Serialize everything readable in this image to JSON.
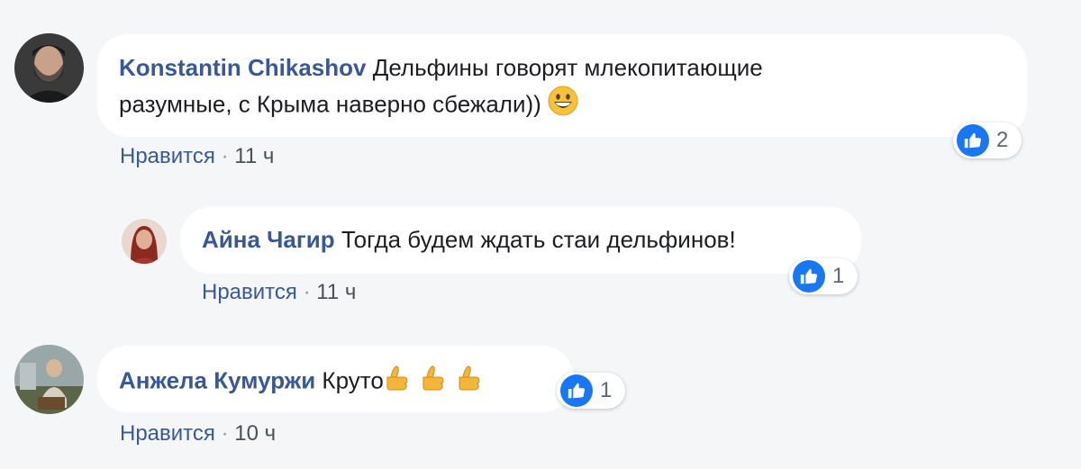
{
  "comments": [
    {
      "author": "Konstantin Chikashov",
      "text_line1": "Дельфины говорят млекопитающие",
      "text_line2": "разумные, с Крыма наверно сбежали))",
      "emoji_icon": "grinning-face-icon",
      "like_label": "Нравится",
      "separator": "·",
      "time": "11 ч",
      "reaction_icon": "like-icon",
      "reaction_count": "2"
    },
    {
      "author": "Айна Чагир",
      "text": "Тогда будем ждать стаи дельфинов!",
      "like_label": "Нравится",
      "separator": "·",
      "time": "11 ч",
      "reaction_icon": "like-icon",
      "reaction_count": "1"
    },
    {
      "author": "Анжела Кумуржи",
      "text": "Круто",
      "emoji_icon": "thumbs-up-hand-icon",
      "like_label": "Нравится",
      "separator": "·",
      "time": "10 ч",
      "reaction_icon": "like-icon",
      "reaction_count": "1"
    }
  ],
  "colors": {
    "background": "#f5f6f7",
    "bubble": "#ffffff",
    "author": "#385898",
    "like_blue": "#1877f2"
  }
}
